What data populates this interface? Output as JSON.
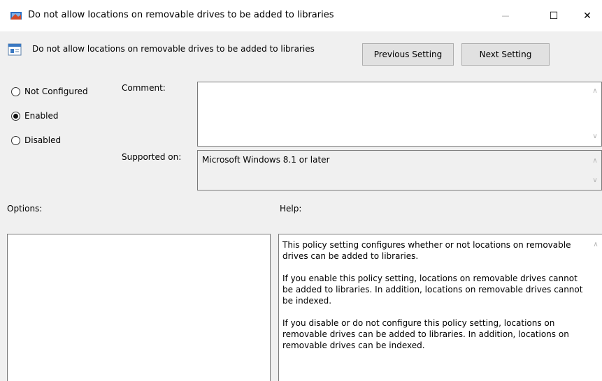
{
  "window": {
    "title": "Do not allow locations on removable drives to be added to libraries",
    "minimize_glyph": "—",
    "maximize_glyph": "☐",
    "close_glyph": "✕"
  },
  "header": {
    "policy_name": "Do not allow locations on removable drives to be added to libraries",
    "previous_label": "Previous Setting",
    "next_label": "Next Setting"
  },
  "state": {
    "options": [
      {
        "label": "Not Configured",
        "checked": false
      },
      {
        "label": "Enabled",
        "checked": true
      },
      {
        "label": "Disabled",
        "checked": false
      }
    ]
  },
  "comment": {
    "label": "Comment:",
    "value": ""
  },
  "supported": {
    "label": "Supported on:",
    "value": "Microsoft Windows 8.1 or later"
  },
  "options_section": {
    "label": "Options:"
  },
  "help_section": {
    "label": "Help:",
    "paragraphs": [
      "This policy setting configures whether or not locations on removable drives can be added to libraries.",
      "If you enable this policy setting, locations on removable drives cannot be added to libraries.  In addition, locations on removable drives cannot be indexed.",
      "If you disable or do not configure this policy setting, locations on removable drives can be added to libraries.  In addition, locations on removable drives can be indexed."
    ]
  }
}
